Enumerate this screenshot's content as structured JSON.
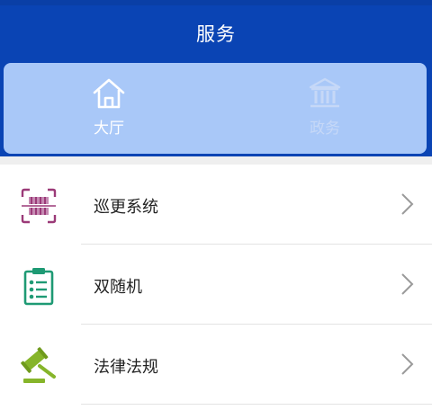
{
  "header": {
    "title": "服务",
    "background_color": "#0a44b4"
  },
  "tabs": [
    {
      "label": "大厅",
      "icon": "home-icon",
      "selected": true
    },
    {
      "label": "政务",
      "icon": "government-building-icon",
      "selected": false
    }
  ],
  "menu": {
    "items": [
      {
        "label": "巡更系统",
        "icon": "patrol-scan-icon",
        "icon_color": "#9b3a78"
      },
      {
        "label": "双随机",
        "icon": "clipboard-checklist-icon",
        "icon_color": "#1e9a74"
      },
      {
        "label": "法律法规",
        "icon": "gavel-icon",
        "icon_color": "#86b52a"
      }
    ],
    "trailing_icon": "chevron-right-icon"
  }
}
